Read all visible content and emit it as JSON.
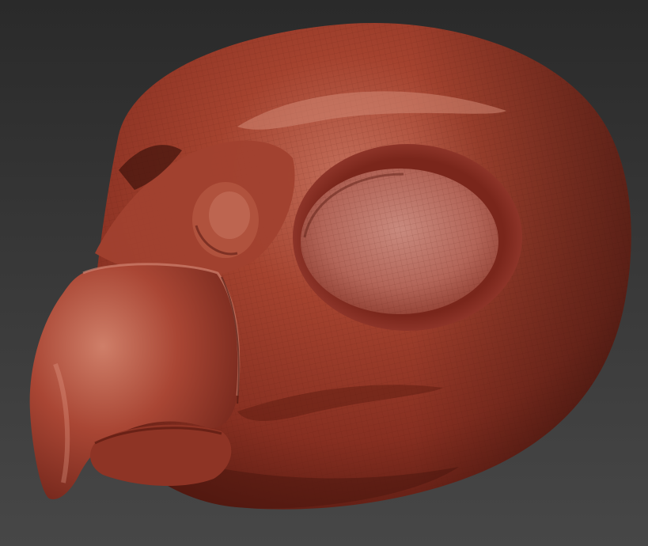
{
  "scene": {
    "subject": "bird-head-sculpt",
    "render_style": "matcap-red-wax",
    "mesh_overlay": true
  },
  "colors": {
    "background_top": "#2a2a2a",
    "background_bottom": "#474747",
    "clay_base": "#a4402f",
    "clay_dark": "#5e1d14",
    "clay_mid": "#8a3324",
    "clay_highlight": "#d58672",
    "eye_socket": "#b4665a",
    "eye_socket_light": "#c97f71",
    "wire": "#6f2418"
  }
}
